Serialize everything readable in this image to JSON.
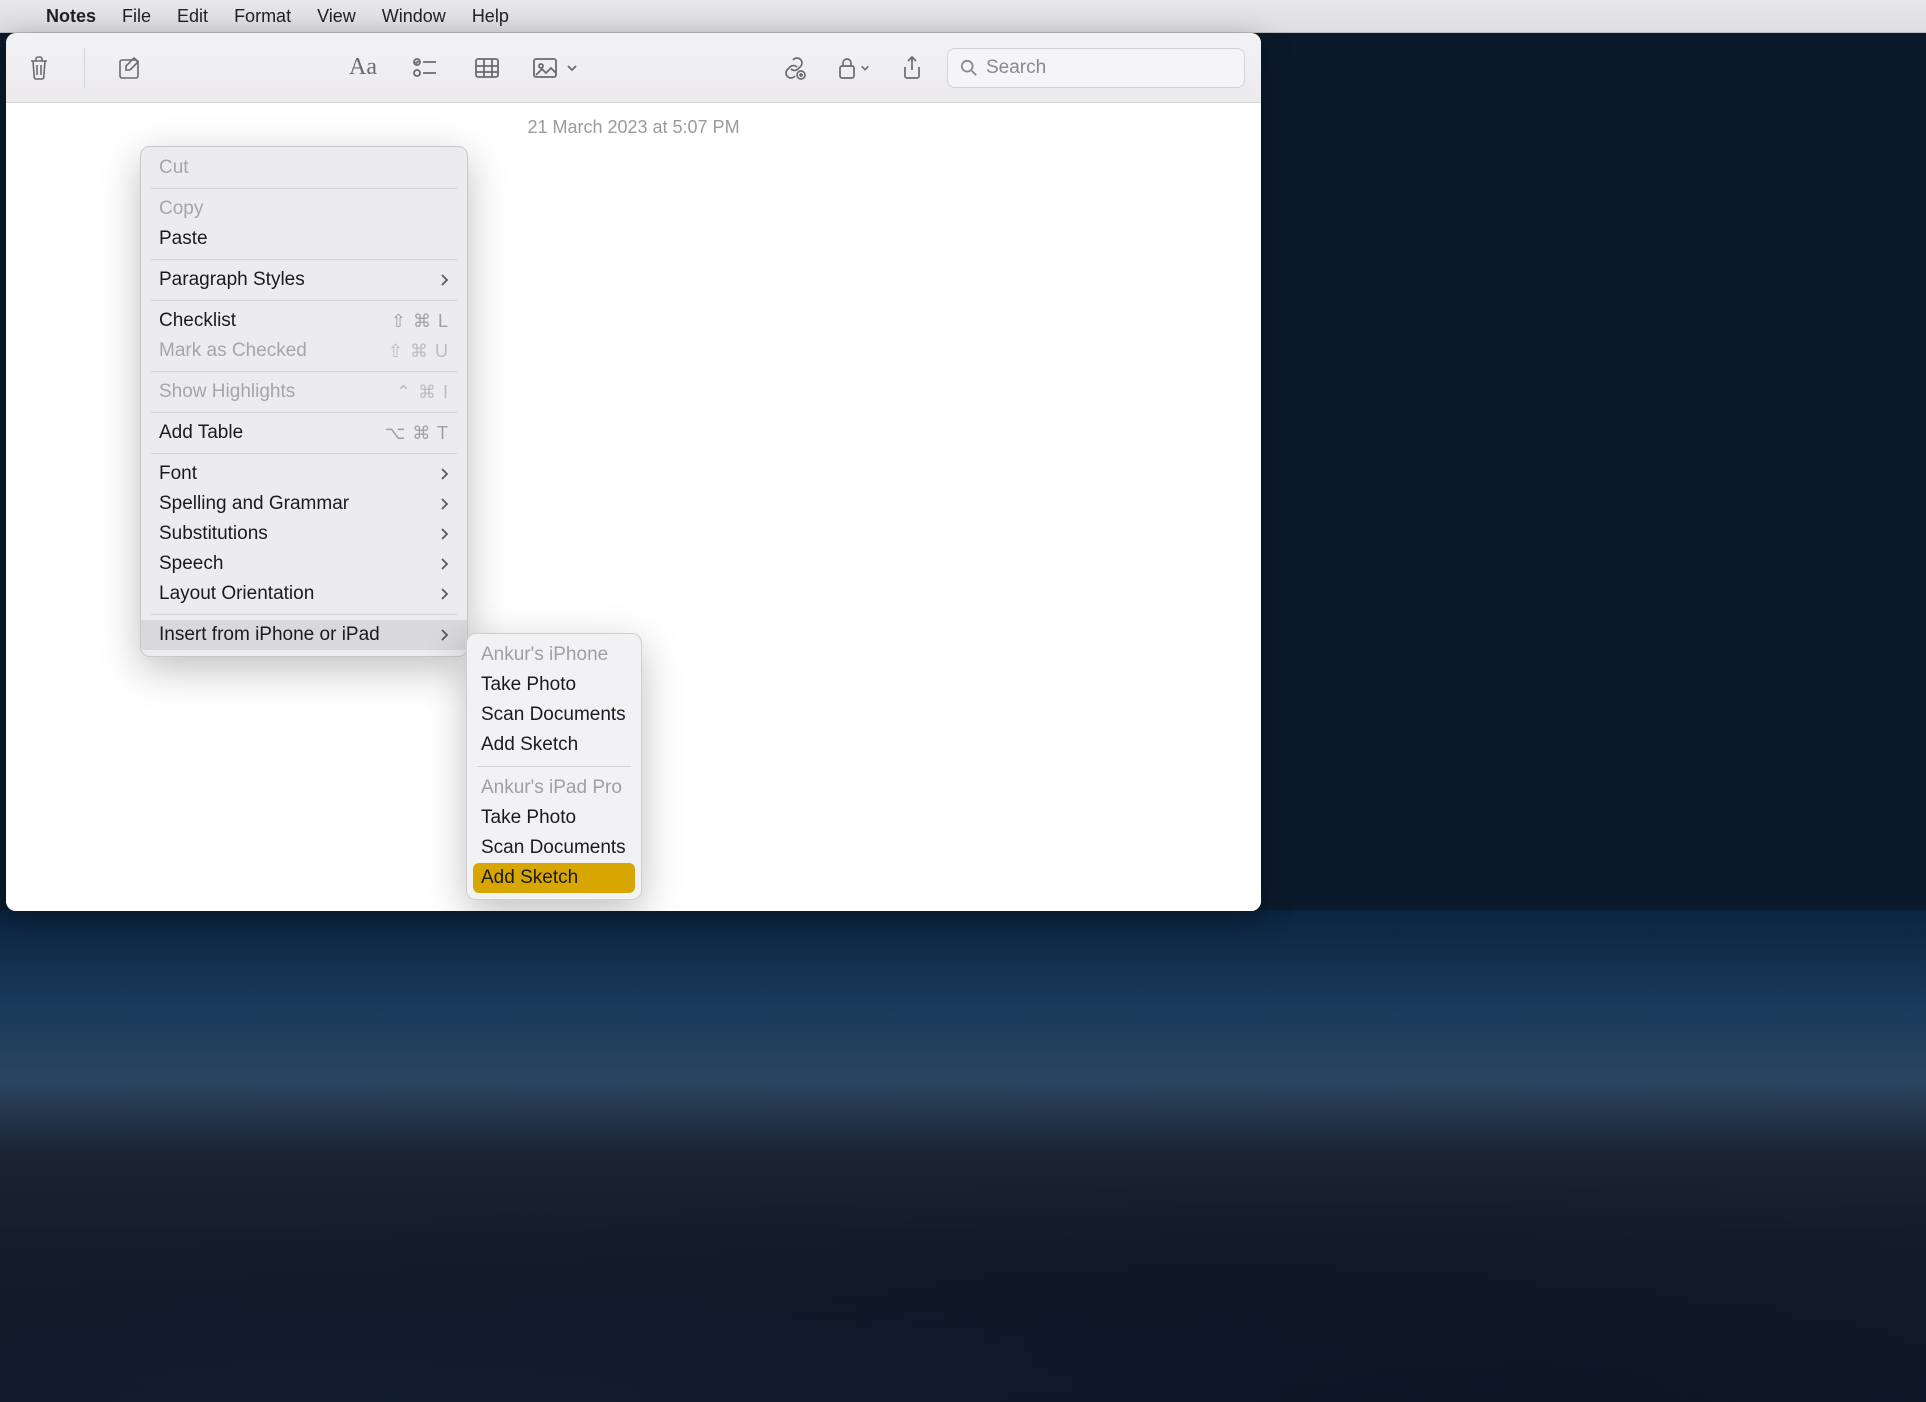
{
  "menubar": {
    "app": "Notes",
    "items": [
      "File",
      "Edit",
      "Format",
      "View",
      "Window",
      "Help"
    ]
  },
  "toolbar": {
    "search_placeholder": "Search"
  },
  "note": {
    "timestamp": "21 March 2023 at 5:07 PM"
  },
  "context_menu": {
    "items": [
      {
        "label": "Cut",
        "disabled": true
      },
      {
        "sep": true
      },
      {
        "label": "Copy",
        "disabled": true
      },
      {
        "label": "Paste"
      },
      {
        "sep": true
      },
      {
        "label": "Paragraph Styles",
        "submenu": true
      },
      {
        "sep": true
      },
      {
        "label": "Checklist",
        "shortcut": "⇧ ⌘ L"
      },
      {
        "label": "Mark as Checked",
        "shortcut": "⇧ ⌘ U",
        "disabled": true
      },
      {
        "sep": true
      },
      {
        "label": "Show Highlights",
        "shortcut": "⌃ ⌘  I",
        "disabled": true
      },
      {
        "sep": true
      },
      {
        "label": "Add Table",
        "shortcut": "⌥ ⌘ T"
      },
      {
        "sep": true
      },
      {
        "label": "Font",
        "submenu": true
      },
      {
        "label": "Spelling and Grammar",
        "submenu": true
      },
      {
        "label": "Substitutions",
        "submenu": true
      },
      {
        "label": "Speech",
        "submenu": true
      },
      {
        "label": "Layout Orientation",
        "submenu": true
      },
      {
        "sep": true
      },
      {
        "label": "Insert from iPhone or iPad",
        "submenu": true,
        "selected": true
      }
    ]
  },
  "submenu": {
    "groups": [
      {
        "header": "Ankur's iPhone",
        "items": [
          {
            "label": "Take Photo"
          },
          {
            "label": "Scan Documents"
          },
          {
            "label": "Add Sketch"
          }
        ]
      },
      {
        "header": "Ankur's iPad Pro",
        "items": [
          {
            "label": "Take Photo"
          },
          {
            "label": "Scan Documents"
          },
          {
            "label": "Add Sketch",
            "highlight": true
          }
        ]
      }
    ]
  }
}
